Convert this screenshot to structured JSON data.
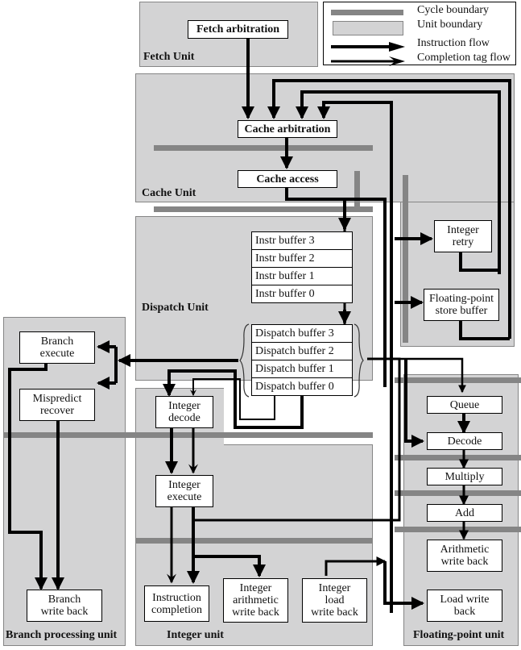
{
  "legend": {
    "cycle_boundary": "Cycle boundary",
    "unit_boundary": "Unit boundary",
    "instruction_flow": "Instruction flow",
    "completion_tag_flow": "Completion tag flow"
  },
  "units": {
    "fetch": "Fetch Unit",
    "cache": "Cache Unit",
    "dispatch": "Dispatch Unit",
    "branch": "Branch processing unit",
    "integer": "Integer unit",
    "floating_point": "Floating-point unit"
  },
  "blocks": {
    "fetch_arbitration": "Fetch arbitration",
    "cache_arbitration": "Cache arbitration",
    "cache_access": "Cache access",
    "instr_buffers": [
      "Instr buffer 3",
      "Instr buffer 2",
      "Instr buffer 1",
      "Instr buffer 0"
    ],
    "dispatch_buffers": [
      "Dispatch buffer 3",
      "Dispatch buffer 2",
      "Dispatch buffer 1",
      "Dispatch buffer 0"
    ],
    "integer_retry": [
      "Integer",
      "retry"
    ],
    "fp_store_buffer": [
      "Floating-point",
      "store buffer"
    ],
    "branch_execute": [
      "Branch",
      "execute"
    ],
    "mispredict_recover": [
      "Mispredict",
      "recover"
    ],
    "branch_write_back": [
      "Branch",
      "write back"
    ],
    "integer_decode": [
      "Integer",
      "decode"
    ],
    "integer_execute": [
      "Integer",
      "execute"
    ],
    "instruction_completion": [
      "Instruction",
      "completion"
    ],
    "integer_arith_write_back": [
      "Integer",
      "arithmetic",
      "write back"
    ],
    "integer_load_write_back": [
      "Integer",
      "load",
      "write back"
    ],
    "queue": "Queue",
    "decode": "Decode",
    "multiply": "Multiply",
    "add": "Add",
    "arith_write_back": [
      "Arithmetic",
      "write back"
    ],
    "load_write_back": [
      "Load write",
      "back"
    ]
  }
}
